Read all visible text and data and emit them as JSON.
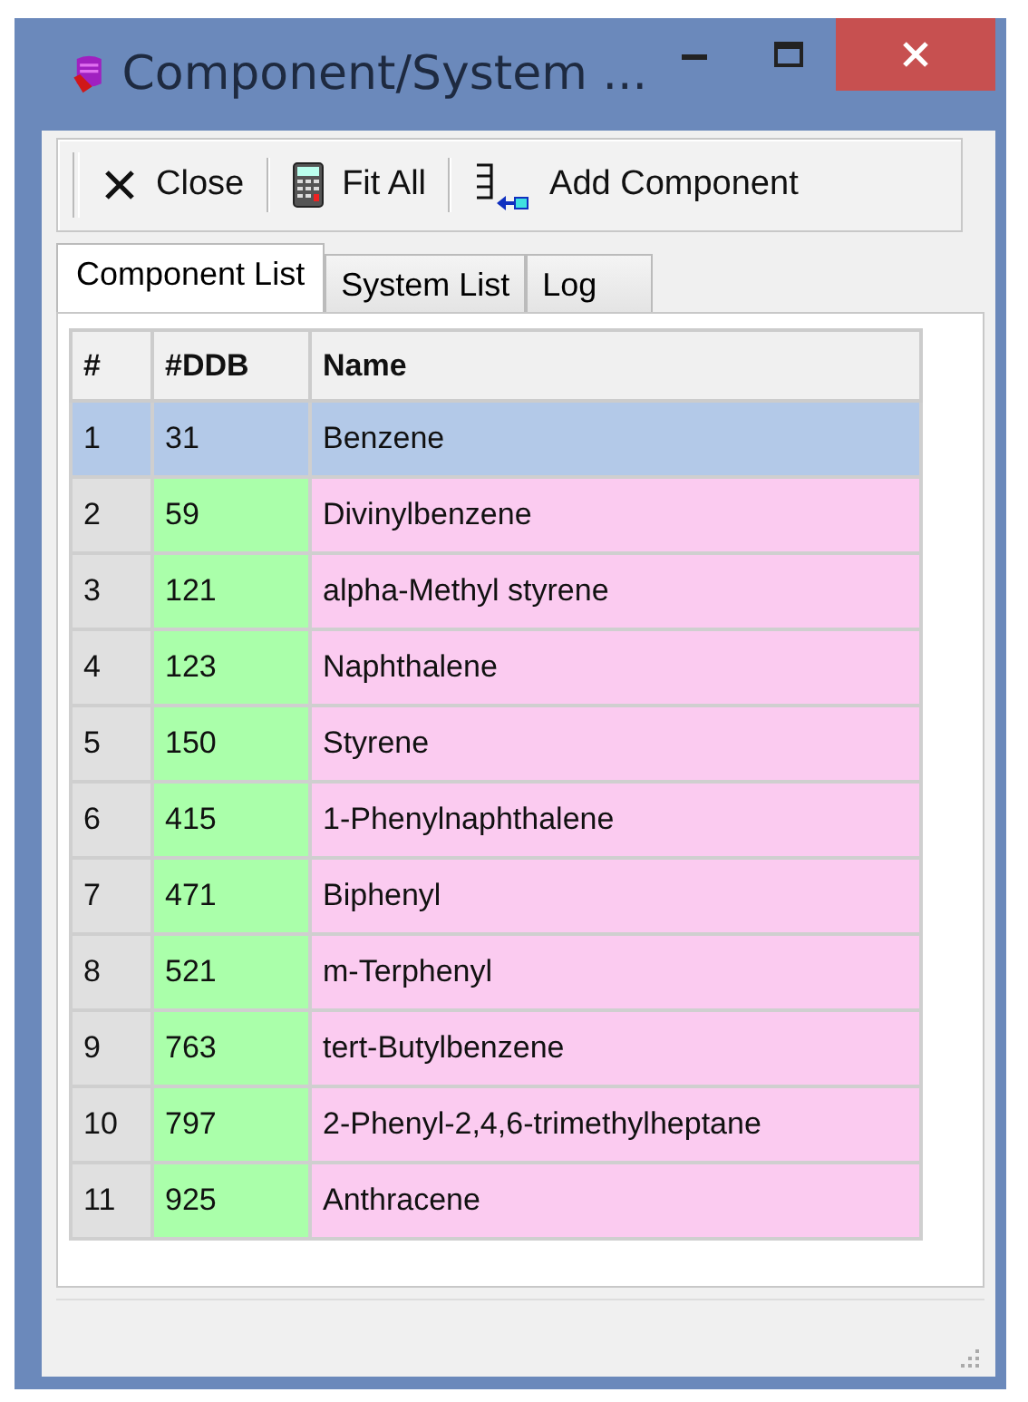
{
  "window": {
    "title": "Component/System ..."
  },
  "toolbar": [
    {
      "kind": "close",
      "label": "Close"
    },
    {
      "kind": "calculator",
      "label": "Fit All"
    },
    {
      "kind": "add",
      "label": "Add Component"
    }
  ],
  "tabs": [
    {
      "label": "Component List",
      "selected": true
    },
    {
      "label": "System List",
      "selected": false
    },
    {
      "label": "Log",
      "selected": false
    }
  ],
  "table": {
    "columns": [
      "#",
      "#DDB",
      "Name"
    ],
    "rows": [
      {
        "cells": [
          "1",
          "31",
          "Benzene"
        ],
        "selected": true
      },
      {
        "cells": [
          "2",
          "59",
          "Divinylbenzene"
        ],
        "selected": false
      },
      {
        "cells": [
          "3",
          "121",
          "alpha-Methyl styrene"
        ],
        "selected": false
      },
      {
        "cells": [
          "4",
          "123",
          "Naphthalene"
        ],
        "selected": false
      },
      {
        "cells": [
          "5",
          "150",
          "Styrene"
        ],
        "selected": false
      },
      {
        "cells": [
          "6",
          "415",
          "1-Phenylnaphthalene"
        ],
        "selected": false
      },
      {
        "cells": [
          "7",
          "471",
          "Biphenyl"
        ],
        "selected": false
      },
      {
        "cells": [
          "8",
          "521",
          "m-Terphenyl"
        ],
        "selected": false
      },
      {
        "cells": [
          "9",
          "763",
          "tert-Butylbenzene"
        ],
        "selected": false
      },
      {
        "cells": [
          "10",
          "797",
          "2-Phenyl-2,4,6-trimethylheptane"
        ],
        "selected": false
      },
      {
        "cells": [
          "11",
          "925",
          "Anthracene"
        ],
        "selected": false
      }
    ]
  }
}
